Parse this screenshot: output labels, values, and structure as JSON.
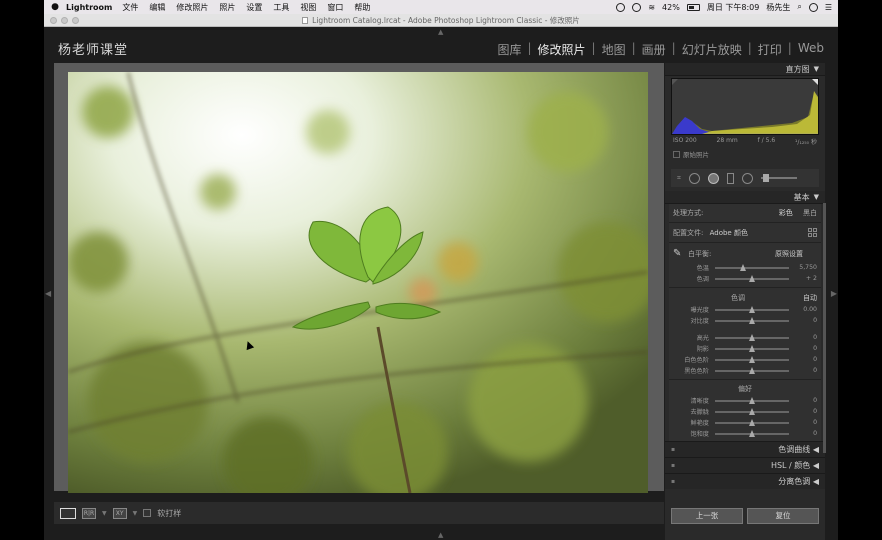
{
  "menubar": {
    "app_name": "Lightroom",
    "items": [
      "文件",
      "编辑",
      "修改照片",
      "照片",
      "设置",
      "工具",
      "视图",
      "窗口",
      "帮助"
    ],
    "battery": "42%",
    "datetime": "周日 下午8:09",
    "user": "杨先生"
  },
  "window": {
    "title": "Lightroom Catalog.lrcat - Adobe Photoshop Lightroom Classic - 修改照片"
  },
  "identity_plate": "杨老师课堂",
  "modules": [
    "图库",
    "修改照片",
    "地图",
    "画册",
    "幻灯片放映",
    "打印",
    "Web"
  ],
  "active_module": "修改照片",
  "toolbar": {
    "grid_label": "XY",
    "softproof_label": "软打样"
  },
  "panel": {
    "histogram_title": "直方图",
    "info": {
      "iso": "ISO 200",
      "focal": "28 mm",
      "aperture": "f / 5.6",
      "shutter": "¹/₁₂₅₀ 秒"
    },
    "original_photo_label": "原始照片",
    "basic_title": "基本",
    "treatment_label": "处理方式:",
    "treatment_color": "彩色",
    "treatment_bw": "黑白",
    "profile_label": "配置文件:",
    "profile_value": "Adobe 颜色",
    "wb_label": "白平衡:",
    "wb_value": "原照设置",
    "sliders_wb": [
      {
        "label": "色温",
        "value": "5,750",
        "pos": 0.38
      },
      {
        "label": "色调",
        "value": "+ 2",
        "pos": 0.5
      }
    ],
    "tone_label": "色调",
    "auto_label": "自动",
    "sliders_tone": [
      {
        "label": "曝光度",
        "value": "0.00",
        "pos": 0.5
      },
      {
        "label": "对比度",
        "value": "0",
        "pos": 0.5
      }
    ],
    "sliders_tone2": [
      {
        "label": "高光",
        "value": "0",
        "pos": 0.5
      },
      {
        "label": "阴影",
        "value": "0",
        "pos": 0.5
      },
      {
        "label": "白色色阶",
        "value": "0",
        "pos": 0.5
      },
      {
        "label": "黑色色阶",
        "value": "0",
        "pos": 0.5
      }
    ],
    "presence_label": "偏好",
    "sliders_presence": [
      {
        "label": "清晰度",
        "value": "0",
        "pos": 0.5
      },
      {
        "label": "去朦胧",
        "value": "0",
        "pos": 0.5
      },
      {
        "label": "鲜艳度",
        "value": "0",
        "pos": 0.5
      },
      {
        "label": "饱和度",
        "value": "0",
        "pos": 0.5
      }
    ],
    "tone_curve_title": "色调曲线",
    "hsl_title": "HSL / 颜色",
    "split_toning_title": "分离色调",
    "previous_button": "上一张",
    "reset_button": "复位"
  }
}
